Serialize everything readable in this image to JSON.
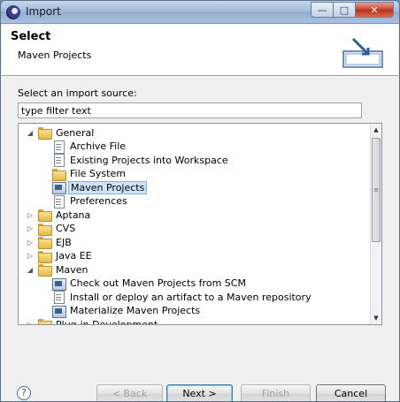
{
  "window": {
    "title": "Import"
  },
  "header": {
    "title": "Select",
    "subtitle": "Maven Projects",
    "icon": "import-wizard-icon"
  },
  "source_label": "Select an import source:",
  "filter": {
    "value": "type filter text"
  },
  "tree": {
    "items": [
      {
        "label": "General",
        "expanded": true,
        "level": 0,
        "icon": "folder-icon"
      },
      {
        "label": "Archive File",
        "level": 1,
        "icon": "file-icon"
      },
      {
        "label": "Existing Projects into Workspace",
        "level": 1,
        "icon": "project-icon"
      },
      {
        "label": "File System",
        "level": 1,
        "icon": "folder-icon"
      },
      {
        "label": "Maven Projects",
        "level": 1,
        "icon": "maven-icon",
        "selected": true
      },
      {
        "label": "Preferences",
        "level": 1,
        "icon": "file-icon"
      },
      {
        "label": "Aptana",
        "expanded": false,
        "level": 0,
        "icon": "folder-icon"
      },
      {
        "label": "CVS",
        "expanded": false,
        "level": 0,
        "icon": "folder-icon"
      },
      {
        "label": "EJB",
        "expanded": false,
        "level": 0,
        "icon": "folder-icon"
      },
      {
        "label": "Java EE",
        "expanded": false,
        "level": 0,
        "icon": "folder-icon"
      },
      {
        "label": "Maven",
        "expanded": true,
        "level": 0,
        "icon": "folder-icon"
      },
      {
        "label": "Check out Maven Projects from SCM",
        "level": 1,
        "icon": "maven-icon"
      },
      {
        "label": "Install or deploy an artifact to a Maven repository",
        "level": 1,
        "icon": "file-icon"
      },
      {
        "label": "Materialize Maven Projects",
        "level": 1,
        "icon": "maven-icon"
      },
      {
        "label": "Plug-in Development",
        "expanded": false,
        "level": 0,
        "icon": "folder-icon"
      }
    ]
  },
  "buttons": {
    "help": "?",
    "back": "< Back",
    "next": "Next >",
    "finish": "Finish",
    "cancel": "Cancel"
  }
}
